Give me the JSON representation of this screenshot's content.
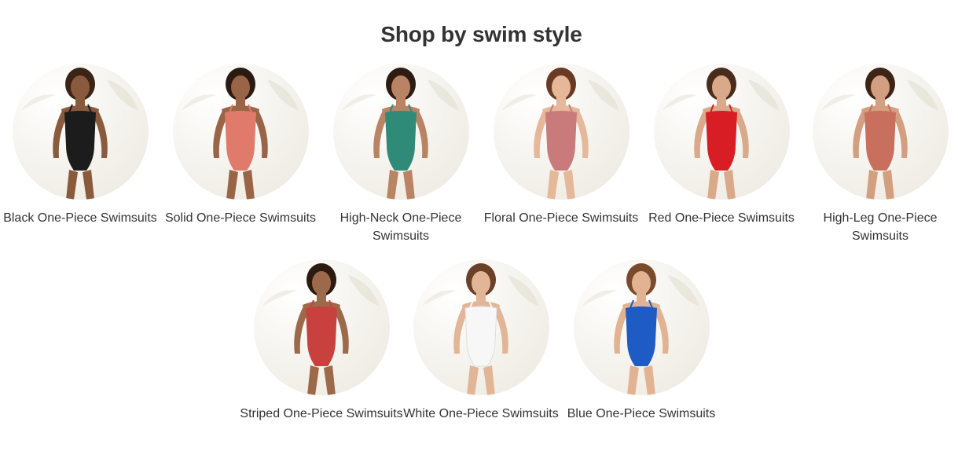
{
  "heading": "Shop by swim style",
  "row1": [
    {
      "label": "Black One-Piece Swimsuits",
      "swimsuit_color": "#1c1c1c",
      "skin": "#8a5a3c",
      "hair": "#3b2416"
    },
    {
      "label": "Solid One-Piece Swimsuits",
      "swimsuit_color": "#e07a6a",
      "skin": "#9a6446",
      "hair": "#2a1a12"
    },
    {
      "label": "High-Neck One-Piece Swimsuits",
      "swimsuit_color": "#2f8a78",
      "skin": "#b98464",
      "hair": "#2e1c12"
    },
    {
      "label": "Floral One-Piece Swimsuits",
      "swimsuit_color": "#c97a7a",
      "skin": "#e6b89a",
      "hair": "#6b3a24"
    },
    {
      "label": "Red One-Piece Swimsuits",
      "swimsuit_color": "#d81e24",
      "skin": "#d9a98a",
      "hair": "#4a2c1c"
    },
    {
      "label": "High-Leg One-Piece Swimsuits",
      "swimsuit_color": "#c96f5e",
      "skin": "#d29f80",
      "hair": "#3d2416"
    }
  ],
  "row2": [
    {
      "label": "Striped One-Piece Swimsuits",
      "swimsuit_color": "#c8413f",
      "skin": "#9c6a4a",
      "hair": "#2a1a10"
    },
    {
      "label": "White One-Piece Swimsuits",
      "swimsuit_color": "#f7f7f7",
      "skin": "#e3b597",
      "hair": "#6a4028"
    },
    {
      "label": "Blue One-Piece Swimsuits",
      "swimsuit_color": "#1f5bc4",
      "skin": "#e2b393",
      "hair": "#7a4a2c"
    }
  ]
}
